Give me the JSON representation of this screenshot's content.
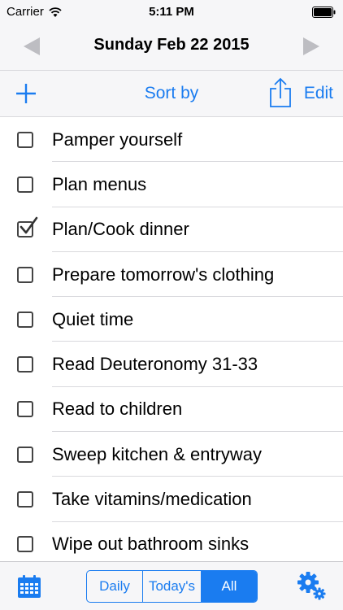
{
  "status_bar": {
    "carrier": "Carrier",
    "time": "5:11 PM",
    "wifi_icon": "wifi-icon",
    "battery_icon": "battery-icon"
  },
  "date_bar": {
    "title": "Sunday Feb 22 2015",
    "prev_icon": "triangle-left-icon",
    "next_icon": "triangle-right-icon"
  },
  "toolbar": {
    "add_icon": "plus-icon",
    "sort_label": "Sort by",
    "share_icon": "share-icon",
    "edit_label": "Edit"
  },
  "tasks": [
    {
      "label": "Pamper yourself",
      "checked": false
    },
    {
      "label": "Plan menus",
      "checked": false
    },
    {
      "label": "Plan/Cook dinner",
      "checked": true
    },
    {
      "label": "Prepare tomorrow's clothing",
      "checked": false
    },
    {
      "label": "Quiet time",
      "checked": false
    },
    {
      "label": "Read Deuteronomy 31-33",
      "checked": false
    },
    {
      "label": "Read to children",
      "checked": false
    },
    {
      "label": "Sweep kitchen & entryway",
      "checked": false
    },
    {
      "label": "Take vitamins/medication",
      "checked": false
    },
    {
      "label": "Wipe out bathroom sinks",
      "checked": false
    }
  ],
  "tab_bar": {
    "calendar_icon": "calendar-icon",
    "segments": [
      {
        "label": "Daily",
        "active": false
      },
      {
        "label": "Today's",
        "active": false
      },
      {
        "label": "All",
        "active": true
      }
    ],
    "settings_icon": "gears-icon"
  },
  "colors": {
    "accent": "#1a7cf0",
    "bar_background": "#f6f6f8",
    "separator": "#d9d9dd"
  }
}
